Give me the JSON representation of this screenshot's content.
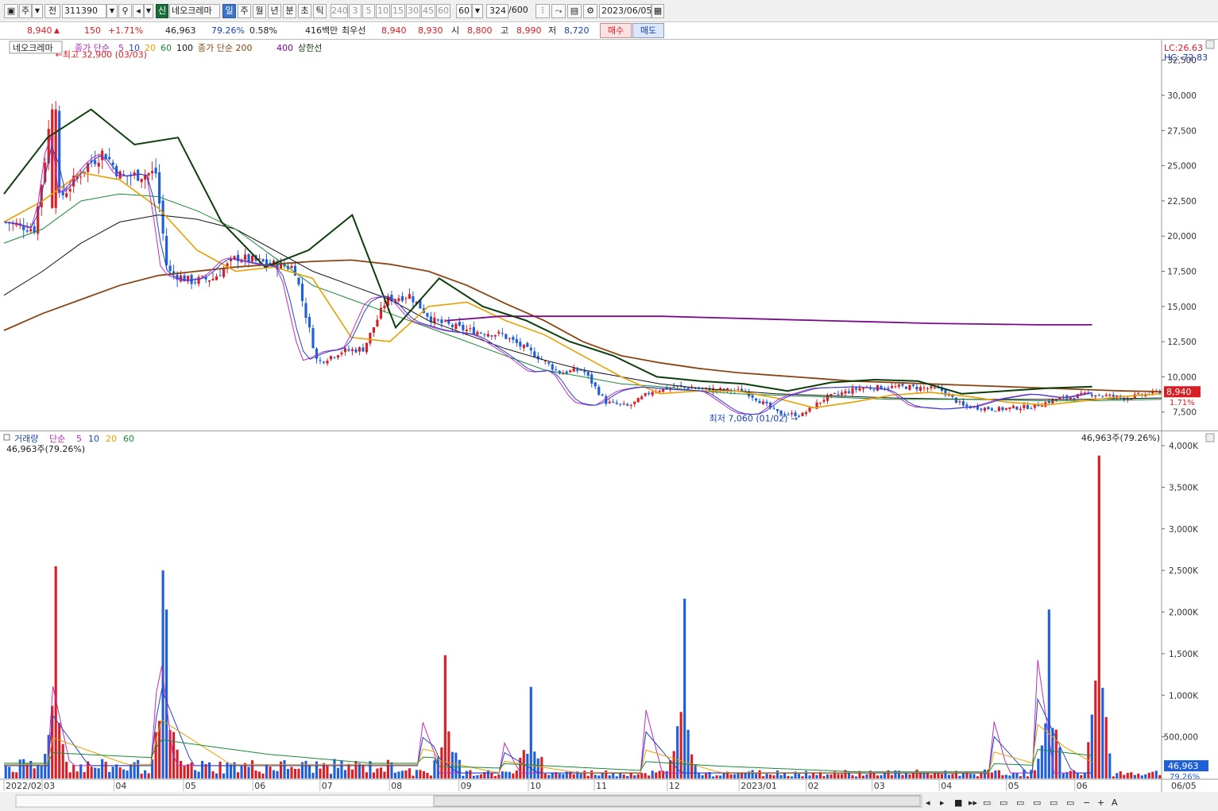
{
  "toolbar": {
    "type_label": "주",
    "market_label": "전",
    "code": "311390",
    "new_badge": "신",
    "name": "네오크레마",
    "periods": [
      "일",
      "주",
      "월",
      "년",
      "분",
      "초",
      "틱"
    ],
    "intervals": [
      "240",
      "3",
      "5",
      "10",
      "15",
      "30",
      "45",
      "60"
    ],
    "interval_input": "60",
    "count": "324",
    "count_total": "/600",
    "date": "2023/06/05"
  },
  "quote": {
    "price": "8,940",
    "change": "150",
    "change_pct": "+1.71%",
    "volume": "46,963",
    "volume_ratio": "79.26%",
    "turnover": "0.58%",
    "amount": "416백만",
    "best_ask_label": "최우선",
    "best_ask": "8,940",
    "best_bid": "8,930",
    "open_label": "시",
    "open": "8,800",
    "high_label": "고",
    "high": "8,990",
    "low_label": "저",
    "low": "8,720",
    "buy_label": "매수",
    "sell_label": "매도"
  },
  "price_panel": {
    "name_label": "네오크레마",
    "legend": [
      {
        "text": "종가 단순",
        "color": "#c02cc0"
      },
      {
        "text": "5",
        "color": "#c02cc0"
      },
      {
        "text": "10",
        "color": "#2244cc"
      },
      {
        "text": "20",
        "color": "#e8a000"
      },
      {
        "text": "60",
        "color": "#1a8a3a"
      },
      {
        "text": "100",
        "color": "#111111"
      },
      {
        "text": "종가 단순 200",
        "color": "#8b4513"
      },
      {
        "text": "400",
        "color": "#7a0a8c"
      },
      {
        "text": "상한선",
        "color": "#0c3d0c"
      }
    ],
    "lc": "LC:26.63",
    "hc": "HC:-72.83",
    "max_label": "최고 32,900 (03/03)",
    "min_label": "최저 7,060 (01/02)",
    "last_price_tag": "8,940",
    "last_change_tag": "1.71%",
    "y_ticks": [
      "32,500",
      "30,000",
      "27,500",
      "25,000",
      "22,500",
      "20,000",
      "17,500",
      "15,000",
      "12,500",
      "10,000",
      "7,500"
    ]
  },
  "volume_panel": {
    "legend": [
      {
        "text": "거래량",
        "color": "#2244aa"
      },
      {
        "text": "단순",
        "color": "#c02cc0"
      },
      {
        "text": "5",
        "color": "#c02cc0"
      },
      {
        "text": "10",
        "color": "#2244cc"
      },
      {
        "text": "20",
        "color": "#e8a000"
      },
      {
        "text": "60",
        "color": "#1a8a3a"
      }
    ],
    "sub_label": "46,963주(79.26%)",
    "right_label": "46,963주(79.26%)",
    "last_tag": "46,963",
    "last_pct_tag": "79.26%",
    "y_ticks": [
      "4,000K",
      "3,500K",
      "3,000K",
      "2,500K",
      "2,000K",
      "1,500K",
      "1,000K",
      "500,000"
    ]
  },
  "x_axis": {
    "labels": [
      "2022/02",
      "03",
      "04",
      "05",
      "06",
      "07",
      "08",
      "09",
      "10",
      "11",
      "12",
      "2023/01",
      "02",
      "03",
      "04",
      "05",
      "06",
      "06/05"
    ]
  },
  "colors": {
    "up": "#d91f26",
    "down": "#1f5fd9",
    "ma5": "#c02cc0",
    "ma10": "#2244cc",
    "ma20": "#e8a000",
    "ma60": "#1a8a3a",
    "ma100": "#111111",
    "ma200": "#8b4513",
    "ma400": "#7a0a8c",
    "envelope": "#0c3d0c"
  },
  "chart_data": {
    "type": "candlestick",
    "price_range": [
      6300,
      33500
    ],
    "volume_range": [
      0,
      4000000
    ],
    "key_points": [
      {
        "label": "최고",
        "value": 32900,
        "date": "03/03"
      },
      {
        "label": "최저",
        "value": 7060,
        "date": "01/02"
      }
    ],
    "close_path": [
      {
        "x": 0,
        "y": 21000
      },
      {
        "x": 0.025,
        "y": 20500
      },
      {
        "x": 0.035,
        "y": 26000
      },
      {
        "x": 0.04,
        "y": 29500
      },
      {
        "x": 0.045,
        "y": 22500
      },
      {
        "x": 0.07,
        "y": 25000
      },
      {
        "x": 0.085,
        "y": 26000
      },
      {
        "x": 0.1,
        "y": 24200
      },
      {
        "x": 0.13,
        "y": 24500
      },
      {
        "x": 0.14,
        "y": 17500
      },
      {
        "x": 0.16,
        "y": 16800
      },
      {
        "x": 0.18,
        "y": 17000
      },
      {
        "x": 0.2,
        "y": 18500
      },
      {
        "x": 0.23,
        "y": 18000
      },
      {
        "x": 0.25,
        "y": 17800
      },
      {
        "x": 0.27,
        "y": 11000
      },
      {
        "x": 0.29,
        "y": 11800
      },
      {
        "x": 0.31,
        "y": 12000
      },
      {
        "x": 0.33,
        "y": 15500
      },
      {
        "x": 0.35,
        "y": 15800
      },
      {
        "x": 0.37,
        "y": 14000
      },
      {
        "x": 0.4,
        "y": 13300
      },
      {
        "x": 0.43,
        "y": 13000
      },
      {
        "x": 0.46,
        "y": 11500
      },
      {
        "x": 0.48,
        "y": 10300
      },
      {
        "x": 0.5,
        "y": 10500
      },
      {
        "x": 0.52,
        "y": 8200
      },
      {
        "x": 0.54,
        "y": 7900
      },
      {
        "x": 0.56,
        "y": 9000
      },
      {
        "x": 0.58,
        "y": 9300
      },
      {
        "x": 0.61,
        "y": 9100
      },
      {
        "x": 0.64,
        "y": 9000
      },
      {
        "x": 0.67,
        "y": 7400
      },
      {
        "x": 0.69,
        "y": 7300
      },
      {
        "x": 0.71,
        "y": 8500
      },
      {
        "x": 0.74,
        "y": 9200
      },
      {
        "x": 0.78,
        "y": 9300
      },
      {
        "x": 0.81,
        "y": 9100
      },
      {
        "x": 0.83,
        "y": 7900
      },
      {
        "x": 0.86,
        "y": 7700
      },
      {
        "x": 0.89,
        "y": 7900
      },
      {
        "x": 0.91,
        "y": 8400
      },
      {
        "x": 0.94,
        "y": 8800
      },
      {
        "x": 0.97,
        "y": 8500
      },
      {
        "x": 1,
        "y": 8940
      }
    ],
    "ma_paths": {
      "ma20": [
        21000,
        22500,
        24500,
        24000,
        22000,
        19000,
        17500,
        17800,
        17000,
        12800,
        12500,
        15000,
        15300,
        14000,
        13000,
        11500,
        10000,
        8800,
        9000,
        9000,
        8500,
        7800,
        8200,
        8700,
        8900,
        8600,
        8200,
        8000,
        8300,
        8600,
        8800
      ],
      "ma60": [
        19500,
        20500,
        22500,
        23000,
        22800,
        21800,
        20500,
        18500,
        16500,
        15500,
        14500,
        13500,
        12500,
        11500,
        10500,
        10000,
        9500,
        9300,
        9000,
        8800,
        8700,
        8600,
        8500,
        8400,
        8400,
        8400,
        8350,
        8300,
        8300,
        8350,
        8400
      ],
      "ma100": [
        15800,
        17500,
        19500,
        21000,
        21500,
        21200,
        20500,
        19000,
        17500,
        16500,
        15500,
        14000,
        13000,
        12000,
        11200,
        10500,
        10000,
        9500,
        9200,
        9000,
        8800,
        8700,
        8600,
        8500,
        8450,
        8400,
        8400,
        8400,
        8400,
        8450,
        8500
      ],
      "ma200": [
        13300,
        14500,
        15500,
        16500,
        17200,
        17500,
        17800,
        18000,
        18200,
        18300,
        18000,
        17500,
        16500,
        15200,
        14000,
        12500,
        11500,
        11000,
        10600,
        10300,
        10100,
        9900,
        9700,
        9600,
        9500,
        9400,
        9300,
        9200,
        9100,
        9000,
        8950
      ],
      "ma400": [
        null,
        null,
        null,
        null,
        null,
        null,
        null,
        null,
        null,
        null,
        null,
        null,
        14000,
        14300,
        14300,
        14300,
        14300,
        14200,
        14100,
        14000,
        13900,
        13800,
        13750,
        13700,
        13700
      ]
    },
    "envelope_upper": [
      23000,
      27000,
      29000,
      26500,
      27000,
      21000,
      17800,
      19000,
      21500,
      13500,
      17000,
      15000,
      14000,
      12500,
      11500,
      10000,
      9700,
      9500,
      9000,
      9600,
      9800,
      9700,
      8800,
      9000,
      9200,
      9300
    ],
    "volume_spikes": [
      {
        "x": 0.043,
        "v": 2550000
      },
      {
        "x": 0.137,
        "v": 2500000
      },
      {
        "x": 0.14,
        "v": 2030000
      },
      {
        "x": 0.382,
        "v": 1480000
      },
      {
        "x": 0.456,
        "v": 1100000
      },
      {
        "x": 0.587,
        "v": 2160000
      },
      {
        "x": 0.905,
        "v": 2030000
      },
      {
        "x": 0.947,
        "v": 3880000
      }
    ]
  }
}
